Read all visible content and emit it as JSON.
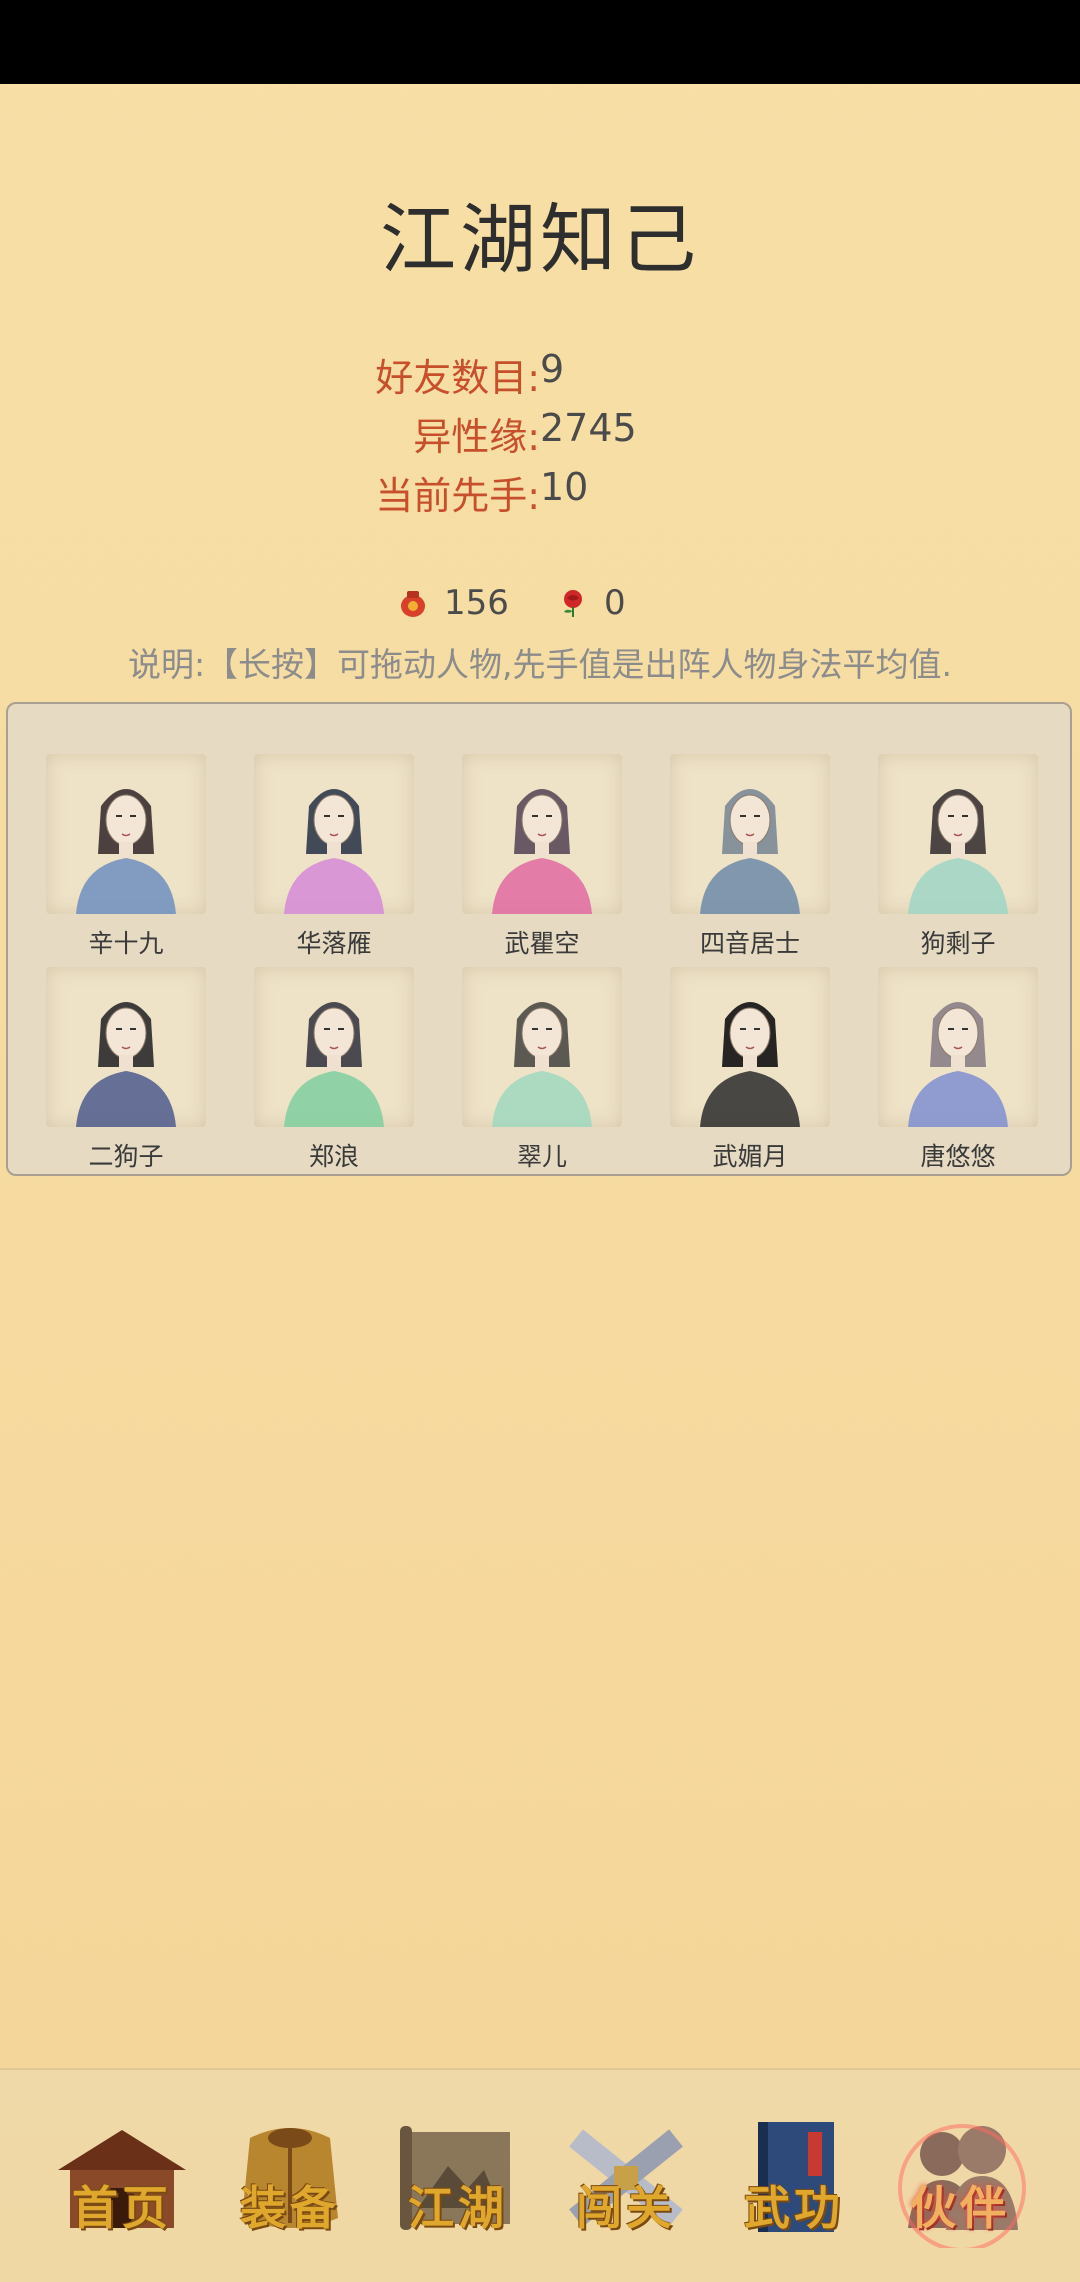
{
  "page_title": "江湖知己",
  "stats": [
    {
      "label": "好友数目:",
      "value": "9"
    },
    {
      "label": "异性缘:",
      "value": "2745"
    },
    {
      "label": "当前先手:",
      "value": "10"
    }
  ],
  "currencies": [
    {
      "icon": "red-pouch-icon",
      "value": "156"
    },
    {
      "icon": "rose-icon",
      "value": "0"
    }
  ],
  "hint": "说明:【长按】可拖动人物,先手值是出阵人物身法平均值.",
  "characters": [
    {
      "name": "辛十九",
      "robe": "#6f8fbf",
      "hair": "#3a3030"
    },
    {
      "name": "华落雁",
      "robe": "#d58ad8",
      "hair": "#2f3a4a"
    },
    {
      "name": "武瞿空",
      "robe": "#e06aa0",
      "hair": "#5a4a5a"
    },
    {
      "name": "四音居士",
      "robe": "#6d8aa8",
      "hair": "#7c8a96"
    },
    {
      "name": "狗剩子",
      "robe": "#9fd6c6",
      "hair": "#3a3434"
    },
    {
      "name": "二狗子",
      "robe": "#4d5b8c",
      "hair": "#2a2a2a"
    },
    {
      "name": "郑浪",
      "robe": "#7fcf9f",
      "hair": "#3a3a44"
    },
    {
      "name": "翠儿",
      "robe": "#9fd8c0",
      "hair": "#4a4a44"
    },
    {
      "name": "武媚月",
      "robe": "#2b2b2b",
      "hair": "#111111"
    },
    {
      "name": "唐悠悠",
      "robe": "#7f8ed0",
      "hair": "#8a7f86"
    }
  ],
  "tabs": [
    {
      "label": "首页",
      "icon": "house-icon",
      "active": false
    },
    {
      "label": "装备",
      "icon": "armor-icon",
      "active": false
    },
    {
      "label": "江湖",
      "icon": "scroll-map-icon",
      "active": false
    },
    {
      "label": "闯关",
      "icon": "crossed-swords-icon",
      "active": false
    },
    {
      "label": "武功",
      "icon": "book-icon",
      "active": false
    },
    {
      "label": "伙伴",
      "icon": "partners-icon",
      "active": true
    }
  ]
}
